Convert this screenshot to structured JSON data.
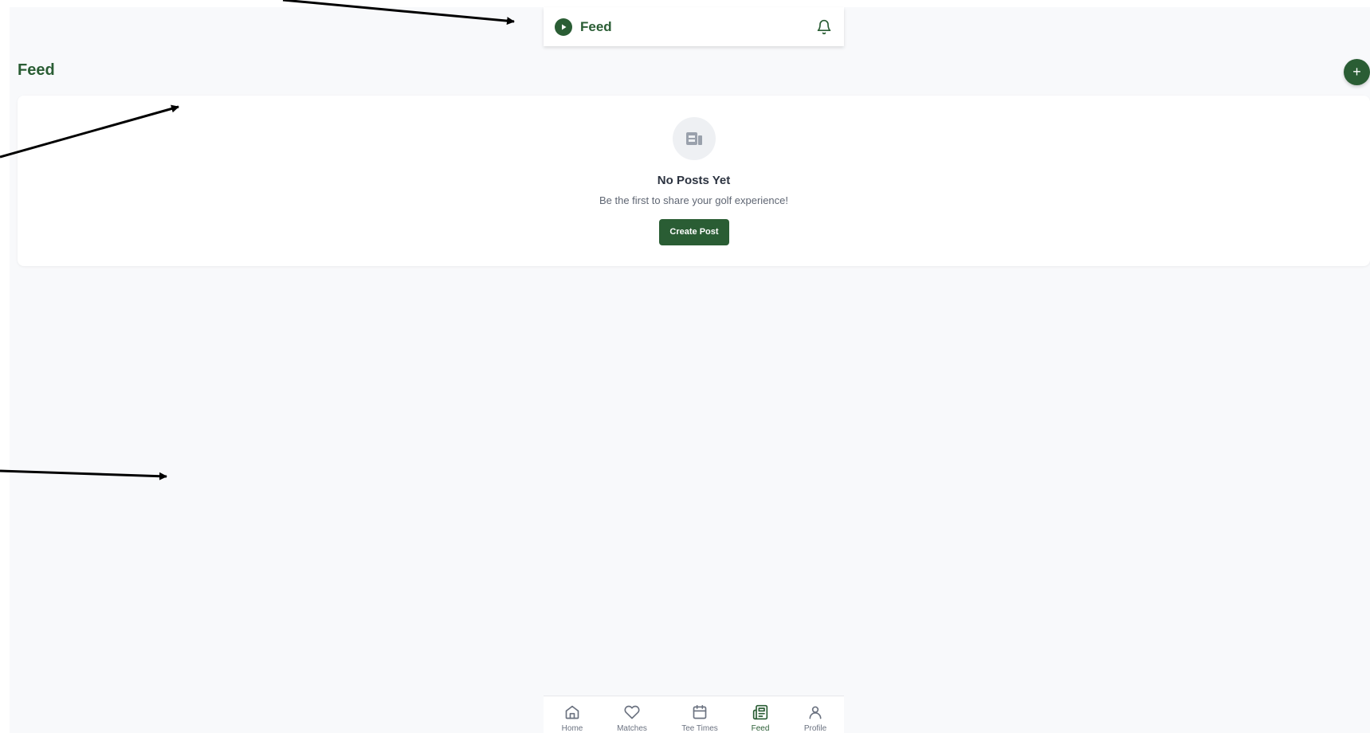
{
  "app_bar": {
    "title": "Feed",
    "logo_icon": "play-circle-icon",
    "notification_icon": "bell-icon"
  },
  "page": {
    "heading": "Feed",
    "add_button_label": "+"
  },
  "empty_state": {
    "icon": "newspaper-icon",
    "title": "No Posts Yet",
    "subtitle": "Be the first to share your golf experience!",
    "button_label": "Create Post"
  },
  "bottom_nav": {
    "items": [
      {
        "label": "Home",
        "icon": "home-icon",
        "active": false
      },
      {
        "label": "Matches",
        "icon": "heart-icon",
        "active": false
      },
      {
        "label": "Tee Times",
        "icon": "calendar-icon",
        "active": false
      },
      {
        "label": "Feed",
        "icon": "newspaper-icon",
        "active": true
      },
      {
        "label": "Profile",
        "icon": "user-icon",
        "active": false
      }
    ]
  },
  "colors": {
    "brand": "#2a5d34",
    "background": "#f8f9fb",
    "muted_text": "#6b7280"
  }
}
